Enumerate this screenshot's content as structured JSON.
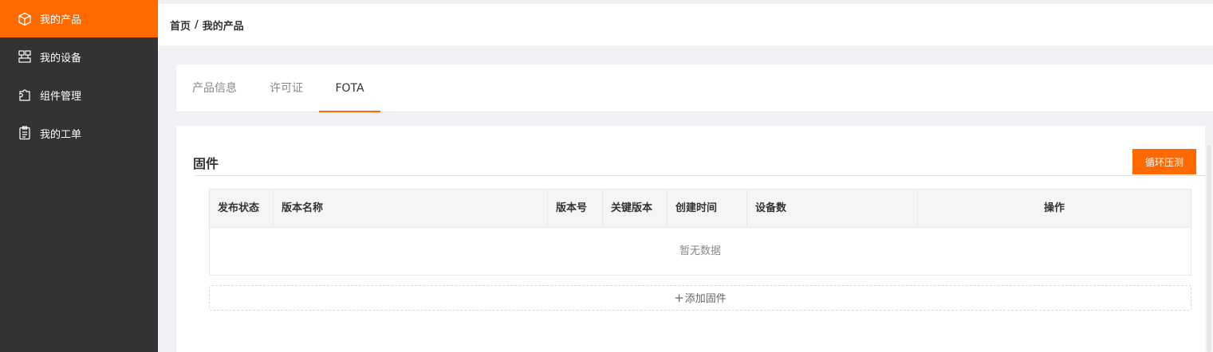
{
  "sidebar": {
    "items": [
      {
        "label": "我的产品",
        "icon": "cube-icon",
        "active": true
      },
      {
        "label": "我的设备",
        "icon": "device-network-icon",
        "active": false
      },
      {
        "label": "组件管理",
        "icon": "puzzle-icon",
        "active": false
      },
      {
        "label": "我的工单",
        "icon": "clipboard-icon",
        "active": false
      }
    ]
  },
  "breadcrumb": {
    "home": "首页",
    "separator": "/",
    "current": "我的产品"
  },
  "tabs": [
    {
      "label": "产品信息",
      "active": false
    },
    {
      "label": "许可证",
      "active": false
    },
    {
      "label": "FOTA",
      "active": true
    }
  ],
  "firmware": {
    "title": "固件",
    "stress_test_button": "循环压测",
    "columns": [
      "发布状态",
      "版本名称",
      "版本号",
      "关键版本",
      "创建时间",
      "设备数",
      "操作"
    ],
    "empty_text": "暂无数据",
    "add_plus": "+",
    "add_label": "添加固件"
  },
  "colors": {
    "accent": "#ff6a00",
    "sidebar_bg": "#333333"
  }
}
